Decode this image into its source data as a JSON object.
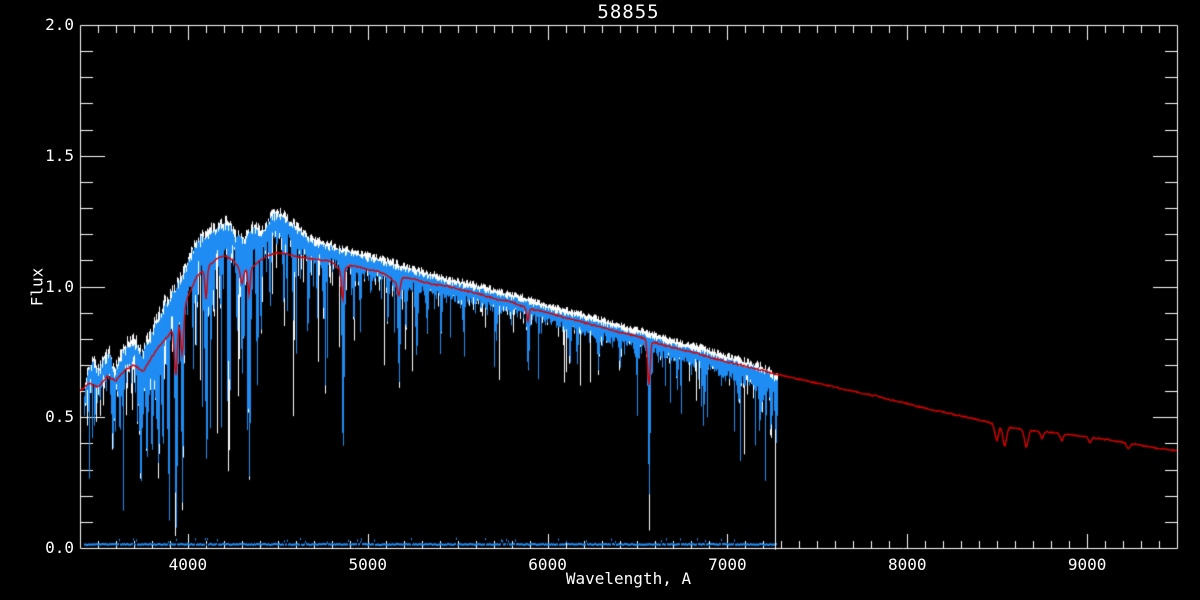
{
  "window": {
    "background": "#000000",
    "foreground": "#ffffff"
  },
  "chart_data": {
    "type": "line",
    "title": "58855",
    "xlabel": "Wavelength, A",
    "ylabel": "Flux",
    "xlim": [
      3400,
      9500
    ],
    "ylim": [
      0.0,
      2.0
    ],
    "grid": false,
    "axis_color": "#ffffff",
    "x_major_ticks": [
      4000,
      5000,
      6000,
      7000,
      8000,
      9000
    ],
    "x_tick_labels": [
      "4000",
      "5000",
      "6000",
      "7000",
      "8000",
      "9000"
    ],
    "x_minor_step": 100,
    "y_major_ticks": [
      0.0,
      0.5,
      1.0,
      1.5,
      2.0
    ],
    "y_tick_labels": [
      "0.0",
      "0.5",
      "1.0",
      "1.5",
      "2.0"
    ],
    "y_minor_step": 0.1,
    "series": [
      {
        "name": "observed-raw",
        "description": "unsmoothed observed spectrum drawn behind, white tips visible above blue",
        "color": "#ffffff",
        "x_range": [
          3422,
          7275
        ],
        "offset_above_observed": 0.02
      },
      {
        "name": "observed",
        "description": "observed spectrum, noisy with deep absorption lines",
        "color": "#1e8cf2",
        "x_range": [
          3422,
          7275
        ],
        "continuum": [
          [
            3422,
            0.57
          ],
          [
            3440,
            0.66
          ],
          [
            3470,
            0.7
          ],
          [
            3500,
            0.66
          ],
          [
            3530,
            0.7
          ],
          [
            3560,
            0.73
          ],
          [
            3590,
            0.66
          ],
          [
            3620,
            0.72
          ],
          [
            3660,
            0.76
          ],
          [
            3700,
            0.78
          ],
          [
            3740,
            0.72
          ],
          [
            3790,
            0.8
          ],
          [
            3830,
            0.86
          ],
          [
            3870,
            0.92
          ],
          [
            3910,
            0.95
          ],
          [
            3950,
            1.0
          ],
          [
            4000,
            1.08
          ],
          [
            4040,
            1.15
          ],
          [
            4080,
            1.17
          ],
          [
            4120,
            1.19
          ],
          [
            4170,
            1.22
          ],
          [
            4220,
            1.23
          ],
          [
            4260,
            1.18
          ],
          [
            4310,
            1.16
          ],
          [
            4360,
            1.21
          ],
          [
            4420,
            1.2
          ],
          [
            4470,
            1.26
          ],
          [
            4520,
            1.26
          ],
          [
            4570,
            1.23
          ],
          [
            4620,
            1.2
          ],
          [
            4680,
            1.17
          ],
          [
            4740,
            1.15
          ],
          [
            4800,
            1.14
          ],
          [
            4880,
            1.12
          ],
          [
            4950,
            1.11
          ],
          [
            5050,
            1.09
          ],
          [
            5150,
            1.07
          ],
          [
            5250,
            1.05
          ],
          [
            5350,
            1.03
          ],
          [
            5450,
            1.01
          ],
          [
            5550,
            0.995
          ],
          [
            5650,
            0.98
          ],
          [
            5750,
            0.96
          ],
          [
            5850,
            0.945
          ],
          [
            5950,
            0.92
          ],
          [
            6050,
            0.9
          ],
          [
            6150,
            0.885
          ],
          [
            6250,
            0.865
          ],
          [
            6350,
            0.845
          ],
          [
            6450,
            0.825
          ],
          [
            6550,
            0.81
          ],
          [
            6650,
            0.785
          ],
          [
            6750,
            0.765
          ],
          [
            6850,
            0.75
          ],
          [
            6950,
            0.725
          ],
          [
            7050,
            0.705
          ],
          [
            7150,
            0.685
          ],
          [
            7230,
            0.665
          ],
          [
            7275,
            0.63
          ]
        ],
        "noise_amplitude": [
          [
            3422,
            0.16
          ],
          [
            3550,
            0.17
          ],
          [
            3700,
            0.2
          ],
          [
            3850,
            0.22
          ],
          [
            4000,
            0.2
          ],
          [
            4200,
            0.18
          ],
          [
            4400,
            0.15
          ],
          [
            4600,
            0.13
          ],
          [
            4800,
            0.115
          ],
          [
            5000,
            0.1
          ],
          [
            5300,
            0.09
          ],
          [
            5600,
            0.08
          ],
          [
            5900,
            0.075
          ],
          [
            6200,
            0.07
          ],
          [
            6500,
            0.065
          ],
          [
            6800,
            0.07
          ],
          [
            7000,
            0.08
          ],
          [
            7150,
            0.1
          ],
          [
            7275,
            0.13
          ]
        ],
        "absorption_lines": [
          [
            3580,
            0.22,
            7
          ],
          [
            3620,
            0.18,
            5
          ],
          [
            3735,
            0.4,
            7
          ],
          [
            3770,
            0.33,
            6
          ],
          [
            3798,
            0.32,
            6
          ],
          [
            3820,
            0.25,
            5
          ],
          [
            3835,
            0.5,
            6
          ],
          [
            3860,
            0.28,
            5
          ],
          [
            3889,
            0.55,
            6
          ],
          [
            3933,
            0.82,
            7
          ],
          [
            3968,
            0.74,
            7
          ],
          [
            4026,
            0.22,
            5
          ],
          [
            4045,
            0.25,
            5
          ],
          [
            4101,
            0.72,
            7
          ],
          [
            4144,
            0.25,
            5
          ],
          [
            4178,
            0.22,
            5
          ],
          [
            4226,
            0.45,
            5
          ],
          [
            4271,
            0.28,
            5
          ],
          [
            4300,
            0.4,
            7
          ],
          [
            4340,
            0.85,
            7
          ],
          [
            4383,
            0.5,
            5
          ],
          [
            4405,
            0.32,
            5
          ],
          [
            4455,
            0.25,
            5
          ],
          [
            4531,
            0.28,
            5
          ],
          [
            4583,
            0.22,
            5
          ],
          [
            4668,
            0.28,
            5
          ],
          [
            4755,
            0.2,
            5
          ],
          [
            4861,
            0.68,
            7
          ],
          [
            4921,
            0.22,
            5
          ],
          [
            4957,
            0.2,
            5
          ],
          [
            5110,
            0.18,
            5
          ],
          [
            5172,
            0.38,
            7
          ],
          [
            5210,
            0.2,
            5
          ],
          [
            5270,
            0.28,
            6
          ],
          [
            5329,
            0.18,
            5
          ],
          [
            5406,
            0.15,
            5
          ],
          [
            5530,
            0.12,
            5
          ],
          [
            5712,
            0.12,
            5
          ],
          [
            5890,
            0.22,
            6
          ],
          [
            6122,
            0.14,
            5
          ],
          [
            6163,
            0.11,
            4
          ],
          [
            6281,
            0.12,
            6
          ],
          [
            6400,
            0.1,
            5
          ],
          [
            6495,
            0.13,
            5
          ],
          [
            6563,
            0.57,
            6
          ],
          [
            6717,
            0.1,
            5
          ],
          [
            6870,
            0.13,
            7
          ],
          [
            7065,
            0.1,
            5
          ],
          [
            7180,
            0.12,
            8
          ],
          [
            7240,
            0.14,
            6
          ],
          [
            7268,
            0.16,
            5
          ]
        ]
      },
      {
        "name": "model",
        "description": "fitted model spectrum, smooth red line over full range",
        "color": "#dc0000",
        "x_range": [
          3400,
          9500
        ],
        "continuum": [
          [
            3400,
            0.6
          ],
          [
            3450,
            0.63
          ],
          [
            3500,
            0.615
          ],
          [
            3550,
            0.655
          ],
          [
            3600,
            0.64
          ],
          [
            3650,
            0.68
          ],
          [
            3700,
            0.7
          ],
          [
            3750,
            0.675
          ],
          [
            3800,
            0.73
          ],
          [
            3850,
            0.78
          ],
          [
            3900,
            0.82
          ],
          [
            3950,
            0.88
          ],
          [
            4000,
            0.96
          ],
          [
            4050,
            1.04
          ],
          [
            4100,
            1.07
          ],
          [
            4150,
            1.1
          ],
          [
            4200,
            1.12
          ],
          [
            4250,
            1.1
          ],
          [
            4300,
            1.06
          ],
          [
            4350,
            1.07
          ],
          [
            4400,
            1.1
          ],
          [
            4450,
            1.12
          ],
          [
            4500,
            1.13
          ],
          [
            4550,
            1.125
          ],
          [
            4600,
            1.115
          ],
          [
            4650,
            1.11
          ],
          [
            4700,
            1.105
          ],
          [
            4750,
            1.1
          ],
          [
            4800,
            1.095
          ],
          [
            4850,
            1.06
          ],
          [
            4900,
            1.08
          ],
          [
            4950,
            1.075
          ],
          [
            5000,
            1.065
          ],
          [
            5050,
            1.06
          ],
          [
            5100,
            1.045
          ],
          [
            5150,
            1.02
          ],
          [
            5200,
            1.035
          ],
          [
            5250,
            1.03
          ],
          [
            5300,
            1.02
          ],
          [
            5350,
            1.01
          ],
          [
            5400,
            1.005
          ],
          [
            5450,
            1.0
          ],
          [
            5500,
            0.99
          ],
          [
            5600,
            0.975
          ],
          [
            5700,
            0.955
          ],
          [
            5800,
            0.94
          ],
          [
            5900,
            0.915
          ],
          [
            6000,
            0.9
          ],
          [
            6100,
            0.88
          ],
          [
            6200,
            0.862
          ],
          [
            6300,
            0.845
          ],
          [
            6400,
            0.825
          ],
          [
            6500,
            0.81
          ],
          [
            6600,
            0.785
          ],
          [
            6700,
            0.765
          ],
          [
            6800,
            0.75
          ],
          [
            6900,
            0.73
          ],
          [
            7000,
            0.712
          ],
          [
            7100,
            0.695
          ],
          [
            7200,
            0.678
          ],
          [
            7300,
            0.66
          ],
          [
            7400,
            0.645
          ],
          [
            7500,
            0.63
          ],
          [
            7600,
            0.615
          ],
          [
            7700,
            0.6
          ],
          [
            7800,
            0.585
          ],
          [
            7900,
            0.568
          ],
          [
            8000,
            0.552
          ],
          [
            8100,
            0.535
          ],
          [
            8200,
            0.52
          ],
          [
            8300,
            0.505
          ],
          [
            8400,
            0.49
          ],
          [
            8500,
            0.472
          ],
          [
            8600,
            0.458
          ],
          [
            8700,
            0.448
          ],
          [
            8800,
            0.442
          ],
          [
            8900,
            0.433
          ],
          [
            9000,
            0.425
          ],
          [
            9100,
            0.415
          ],
          [
            9200,
            0.405
          ],
          [
            9300,
            0.392
          ],
          [
            9400,
            0.38
          ],
          [
            9500,
            0.372
          ]
        ],
        "absorption_lines": [
          [
            3933,
            0.2,
            8
          ],
          [
            3968,
            0.17,
            8
          ],
          [
            4101,
            0.12,
            6
          ],
          [
            4300,
            0.05,
            8
          ],
          [
            4340,
            0.1,
            6
          ],
          [
            4861,
            0.12,
            6
          ],
          [
            5172,
            0.06,
            8
          ],
          [
            5890,
            0.05,
            6
          ],
          [
            6563,
            0.17,
            7
          ],
          [
            8498,
            0.06,
            10
          ],
          [
            8542,
            0.075,
            10
          ],
          [
            8662,
            0.065,
            10
          ],
          [
            8750,
            0.025,
            8
          ],
          [
            8860,
            0.025,
            8
          ],
          [
            9015,
            0.02,
            8
          ],
          [
            9230,
            0.02,
            10
          ]
        ]
      },
      {
        "name": "noise-floor",
        "description": "error/sky spectrum running just above zero",
        "color": "#1e8cf2",
        "x_range": [
          3422,
          7275
        ],
        "level": 0.012
      }
    ]
  }
}
